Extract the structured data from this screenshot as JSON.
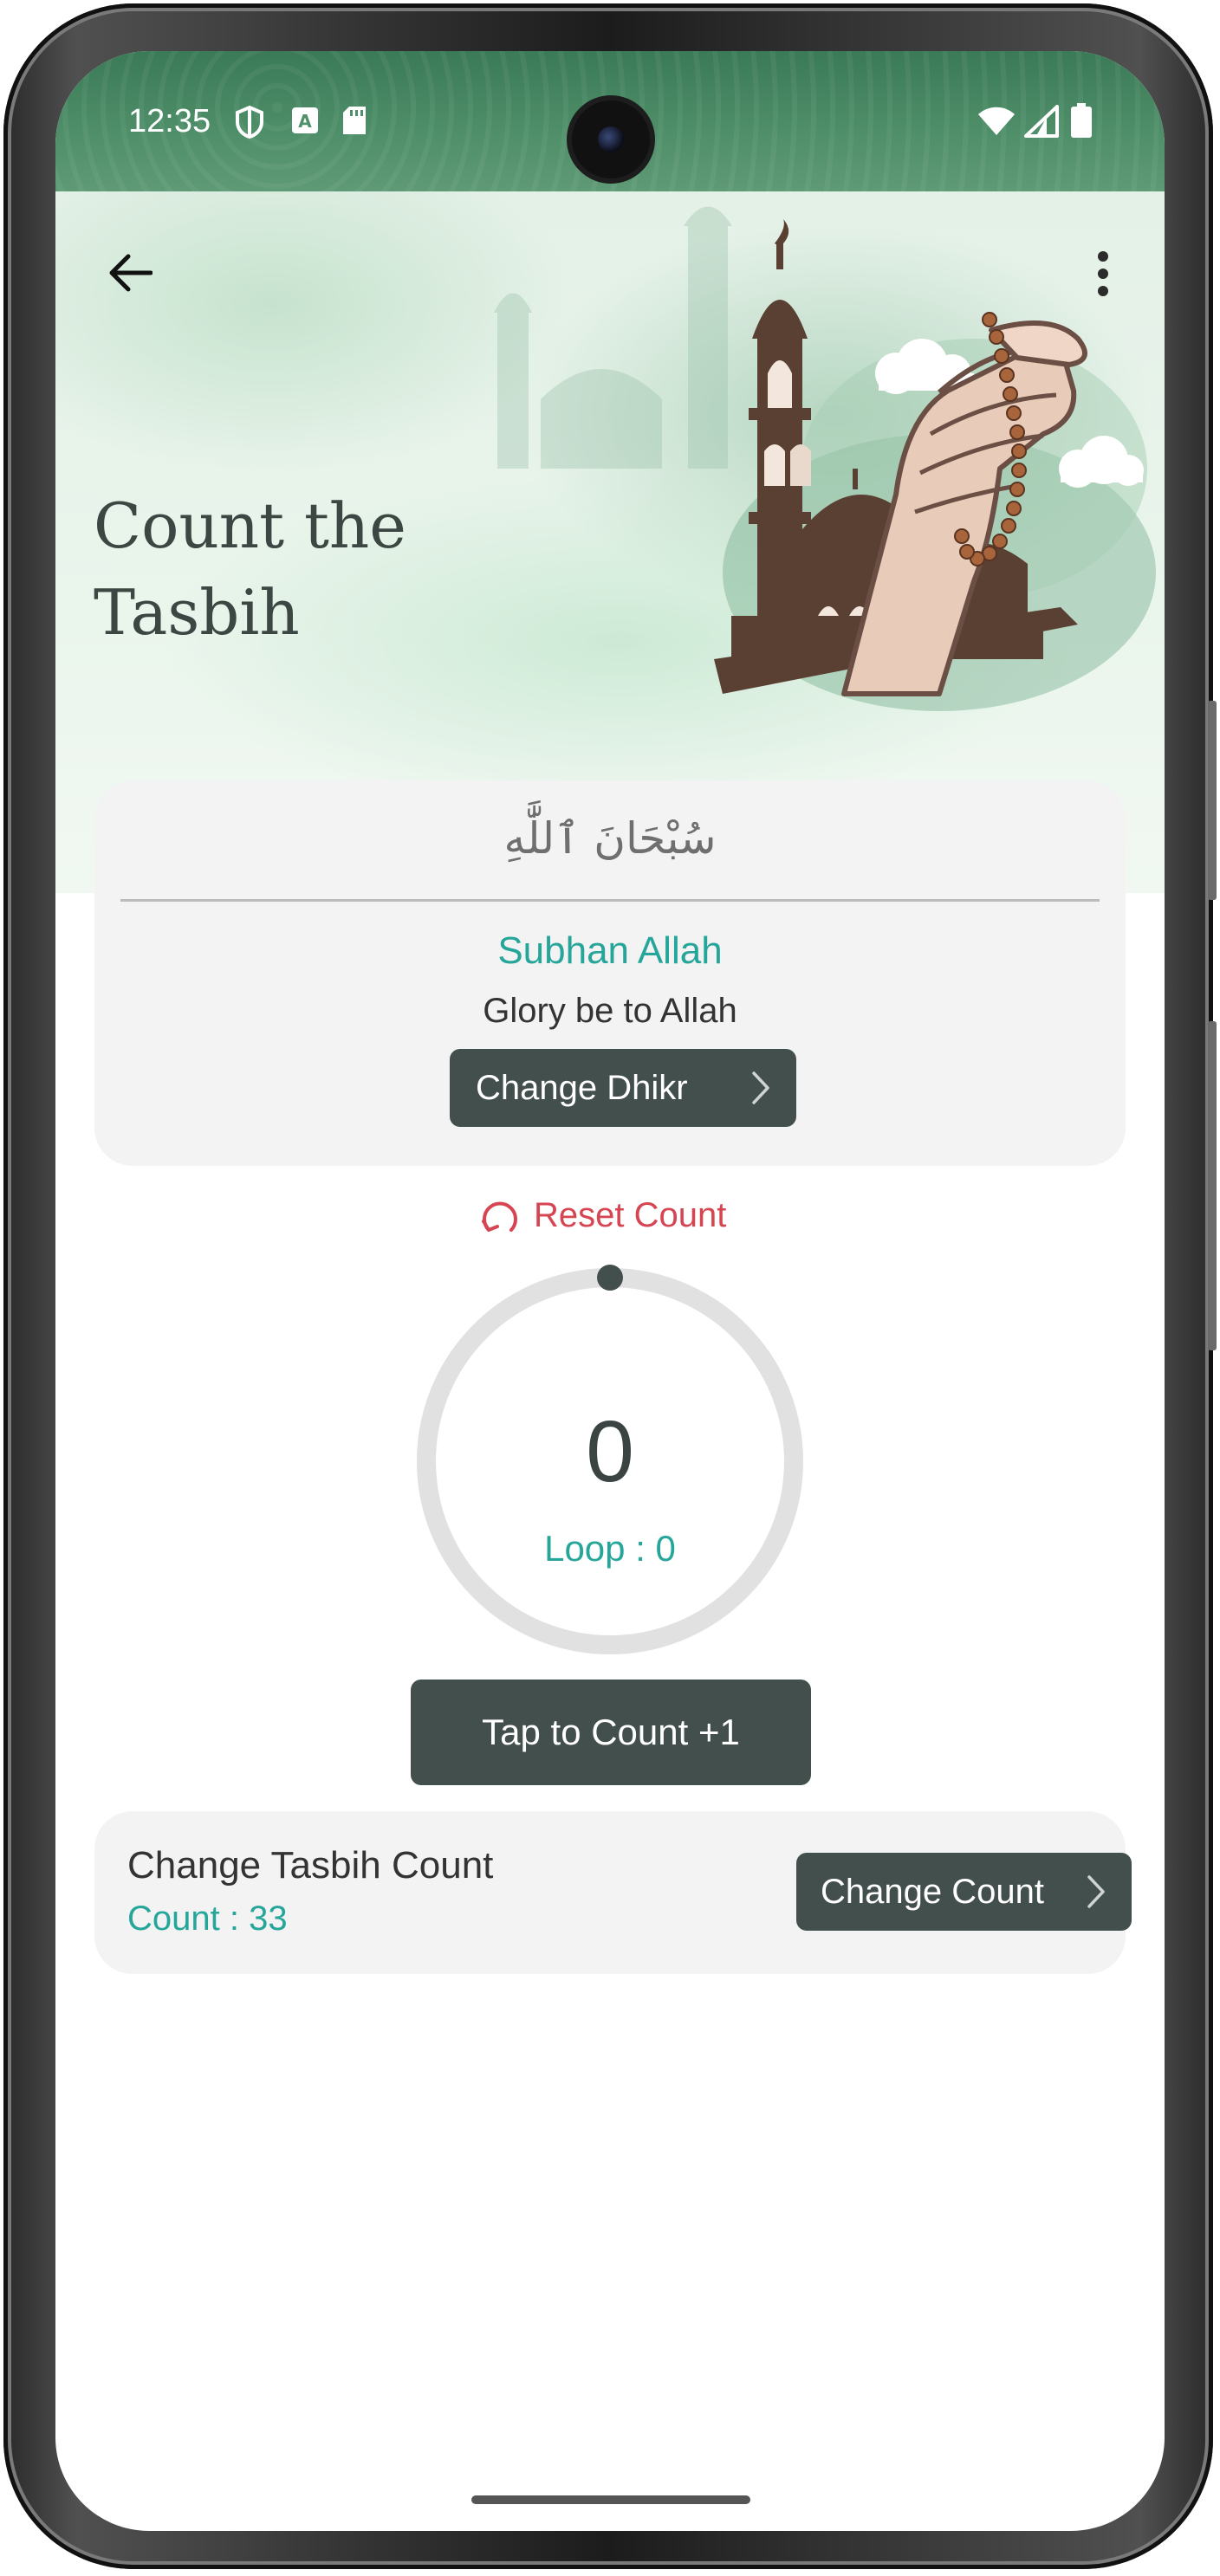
{
  "status_bar": {
    "time": "12:35",
    "icons": [
      "shield-icon",
      "keyboard-a-icon",
      "sd-card-icon",
      "wifi-icon",
      "signal-icon",
      "battery-icon"
    ]
  },
  "header": {
    "title": "Count the Tasbih",
    "back_icon": "arrow-left-icon",
    "menu_icon": "more-vertical-icon"
  },
  "dhikr": {
    "arabic": "سُبْحَانَ ٱللَّٰهِ",
    "transliteration": "Subhan Allah",
    "translation": "Glory be to Allah",
    "change_label": "Change Dhikr"
  },
  "counter": {
    "reset_label": "Reset Count",
    "value": "0",
    "loop": "Loop : 0",
    "tap_label": "Tap to Count +1",
    "progress": 0
  },
  "tasbih": {
    "title": "Change Tasbih Count",
    "count": "Count : 33",
    "change_label": "Change Count"
  },
  "colors": {
    "accent": "#26a69a",
    "dark_button": "#434f4c",
    "reset": "#d64552",
    "card_bg": "#f4f3f4",
    "header_green": "#3b7a57"
  }
}
